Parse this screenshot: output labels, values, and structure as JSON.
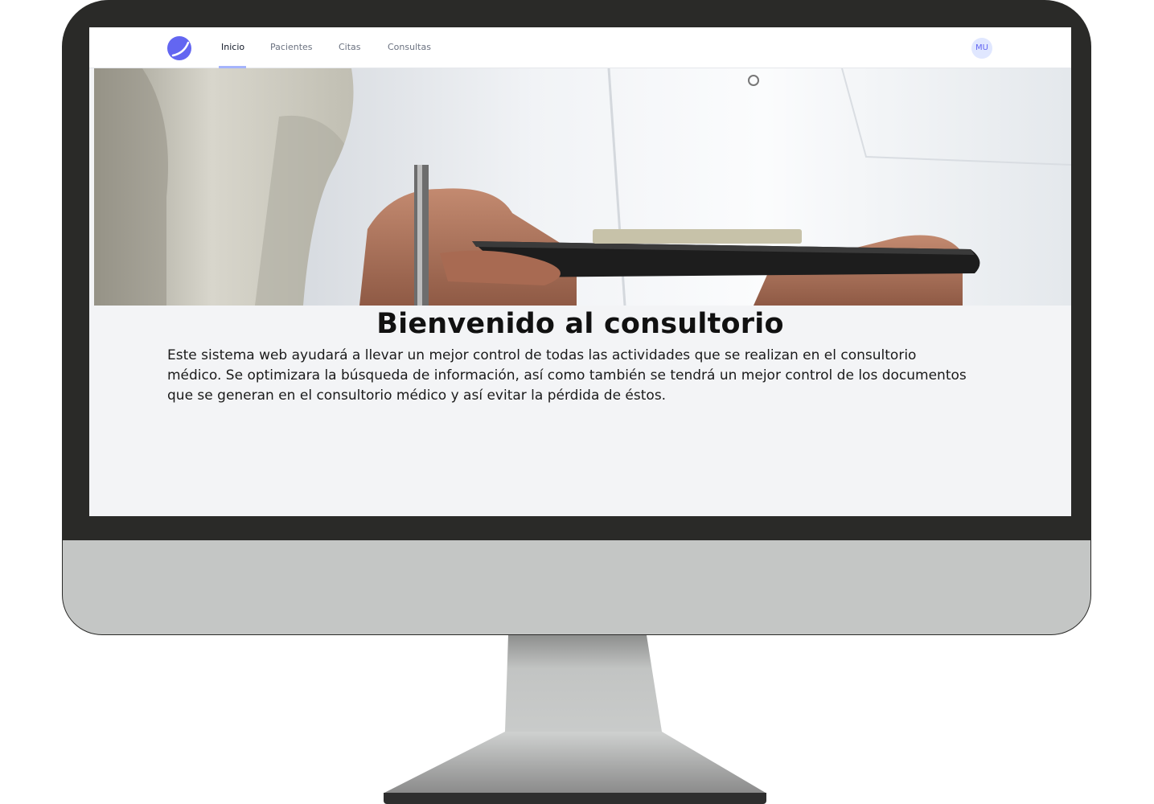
{
  "nav": {
    "links": [
      "Inicio",
      "Pacientes",
      "Citas",
      "Consultas"
    ],
    "active": "Inicio",
    "avatar_initials": "MU"
  },
  "colors": {
    "accent": "#6366f1",
    "background": "#f3f4f6",
    "bezel": "#2a2a28",
    "chin": "#c4c6c5"
  },
  "hero": {
    "image": "doctor-with-clipboard"
  },
  "welcome": {
    "title": "Bienvenido al consultorio",
    "description": "Este sistema web ayudará a llevar un mejor control de todas las actividades que se realizan en el consultorio médico. Se optimizara la búsqueda de información, así como también se tendrá un mejor control de los documentos que se generan en el consultorio médico y así evitar la pérdida de éstos."
  }
}
